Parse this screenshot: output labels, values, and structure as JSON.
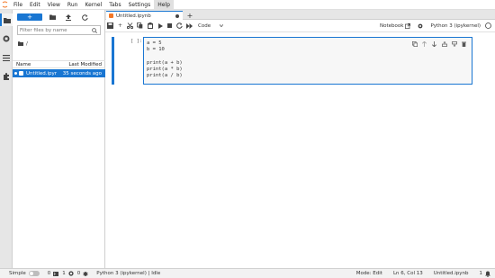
{
  "menubar": {
    "items": [
      "File",
      "Edit",
      "View",
      "Run",
      "Kernel",
      "Tabs",
      "Settings",
      "Help"
    ],
    "active": "Help"
  },
  "filebrowser": {
    "new_label": "+",
    "filter_placeholder": "Filter files by name",
    "breadcrumb": "/",
    "col_name": "Name",
    "col_modified": "Last Modified",
    "files": [
      {
        "name": "Untitled.ipynb",
        "modified": "35 seconds ago"
      }
    ]
  },
  "tabs": [
    {
      "label": "Untitled.ipynb"
    }
  ],
  "toolbar": {
    "cell_type": "Code",
    "notebook_label": "Notebook",
    "kernel_label": "Python 3 (ipykernel)"
  },
  "cell": {
    "prompt": "[ ]:",
    "lines": [
      "a = 5",
      "b = 10",
      "",
      "print(a + b)",
      "print(a * b)",
      "print(a / b)"
    ]
  },
  "statusbar": {
    "mode_label": "Simple",
    "terminals": "0",
    "kernels": "1",
    "debug": "0",
    "kernel_status": "Python 3 (ipykernel) | Idle",
    "mode": "Mode: Edit",
    "position": "Ln 6, Col 13",
    "filename": "Untitled.ipynb",
    "notifications": "1"
  },
  "colors": {
    "accent": "#1976d2",
    "jupyter_orange": "#f37726"
  }
}
